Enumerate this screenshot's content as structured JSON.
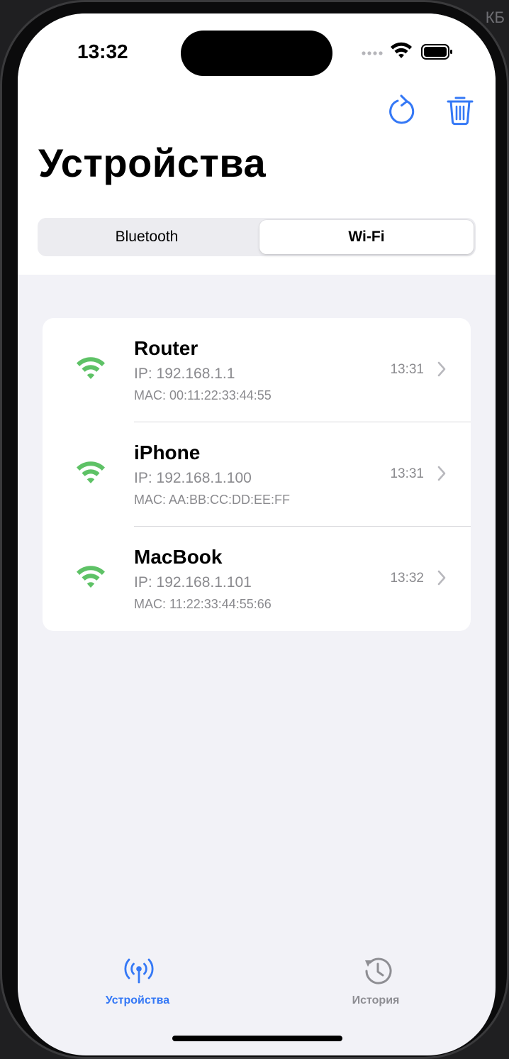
{
  "backdrop": {
    "corner_text": "КБ"
  },
  "status_bar": {
    "time": "13:32"
  },
  "header": {
    "title": "Устройства"
  },
  "segmented": {
    "options": [
      "Bluetooth",
      "Wi-Fi"
    ],
    "selected": "Wi-Fi"
  },
  "devices": [
    {
      "name": "Router",
      "ip": "IP: 192.168.1.1",
      "mac": "MAC: 00:11:22:33:44:55",
      "time": "13:31",
      "icon": "wifi-icon"
    },
    {
      "name": "iPhone",
      "ip": "IP: 192.168.1.100",
      "mac": "MAC: AA:BB:CC:DD:EE:FF",
      "time": "13:31",
      "icon": "wifi-icon"
    },
    {
      "name": "MacBook",
      "ip": "IP: 192.168.1.101",
      "mac": "MAC: 11:22:33:44:55:66",
      "time": "13:32",
      "icon": "wifi-icon"
    }
  ],
  "tabbar": {
    "tabs": [
      {
        "label": "Устройства",
        "icon": "antenna-icon",
        "active": true
      },
      {
        "label": "История",
        "icon": "history-icon",
        "active": false
      }
    ]
  },
  "colors": {
    "accent": "#3478f6",
    "wifi_green": "#5ec266",
    "inactive_tab": "#8e8e93",
    "secondary_text": "#8a8a8e",
    "background": "#f2f2f7"
  }
}
